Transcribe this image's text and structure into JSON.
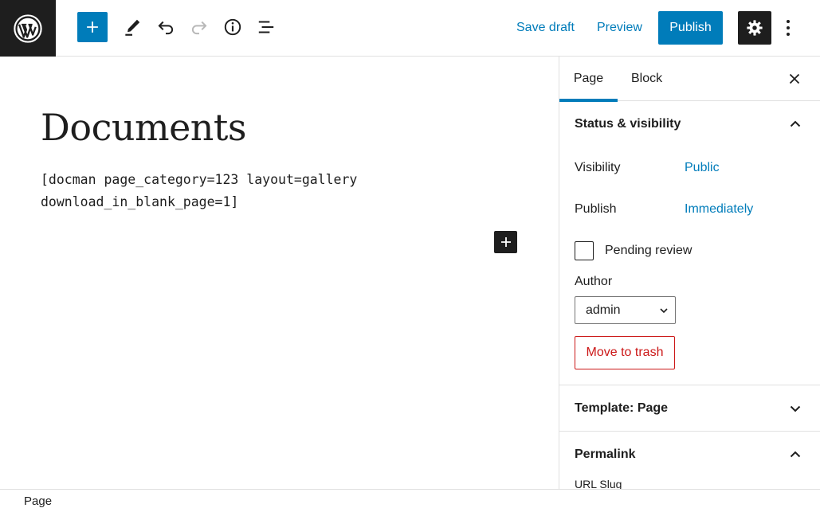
{
  "toolbar": {
    "save_draft": "Save draft",
    "preview": "Preview",
    "publish": "Publish"
  },
  "editor": {
    "title": "Documents",
    "shortcode": "[docman page_category=123 layout=gallery download_in_blank_page=1]"
  },
  "sidebar": {
    "tabs": [
      {
        "label": "Page",
        "active": true
      },
      {
        "label": "Block",
        "active": false
      }
    ],
    "status_visibility": {
      "title": "Status & visibility",
      "visibility_label": "Visibility",
      "visibility_value": "Public",
      "publish_label": "Publish",
      "publish_value": "Immediately",
      "pending_review_label": "Pending review",
      "pending_review_checked": false,
      "author_label": "Author",
      "author_value": "admin",
      "trash_label": "Move to trash"
    },
    "template_panel": {
      "title": "Template: Page"
    },
    "permalink_panel": {
      "title": "Permalink",
      "url_slug_label": "URL Slug"
    }
  },
  "footer": {
    "breadcrumb": "Page"
  },
  "colors": {
    "accent": "#007cba",
    "dark": "#1e1e1e",
    "danger": "#cc1818",
    "border": "#e0e0e0"
  },
  "icons": {
    "logo": "wordpress-logo-icon",
    "inserter": "plus-icon",
    "tools": "pencil-icon",
    "undo": "undo-icon",
    "redo": "redo-icon",
    "details": "info-icon",
    "outline": "list-view-icon",
    "settings": "gear-icon",
    "more": "more-vertical-icon"
  }
}
